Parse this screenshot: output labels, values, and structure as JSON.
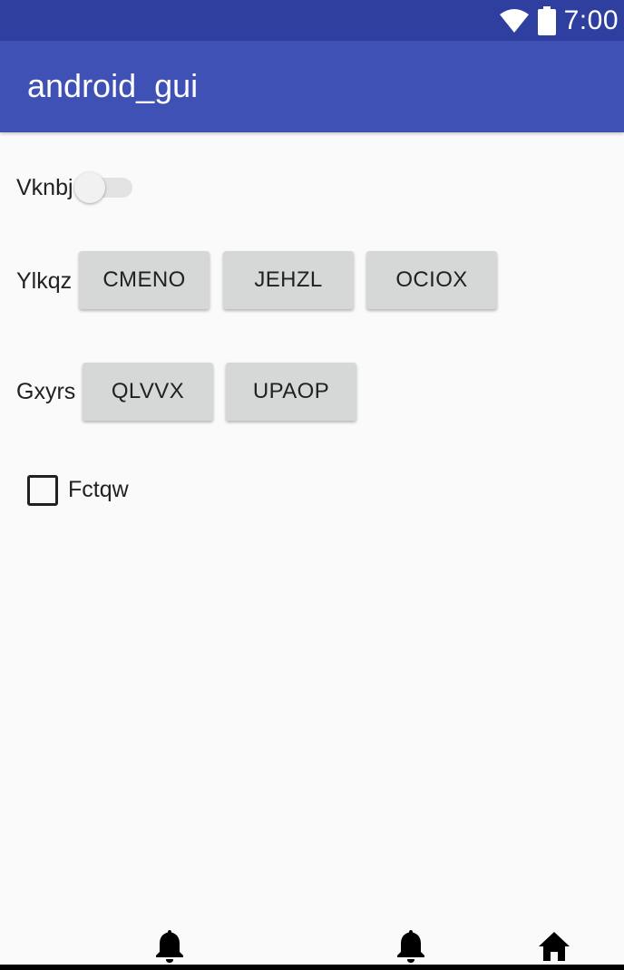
{
  "status_bar": {
    "time": "7:00",
    "icons": [
      "wifi-icon",
      "battery-icon"
    ]
  },
  "app_bar": {
    "title": "android_gui"
  },
  "rows": {
    "switch_row": {
      "label": "Vknbj",
      "checked": false
    },
    "button_row_1": {
      "label": "Ylkqz",
      "buttons": [
        "CMENO",
        "JEHZL",
        "OCIOX"
      ]
    },
    "button_row_2": {
      "label": "Gxyrs",
      "buttons": [
        "QLVVX",
        "UPAOP"
      ]
    },
    "checkbox_row": {
      "label": "Fctqw",
      "checked": false
    }
  },
  "nav_bar": {
    "icons": [
      "bell-icon",
      "bell-icon",
      "home-icon"
    ]
  },
  "colors": {
    "status_bar": "#2f3f9f",
    "app_bar": "#3f51b5",
    "background": "#fafafa",
    "button": "#d6d7d7"
  }
}
